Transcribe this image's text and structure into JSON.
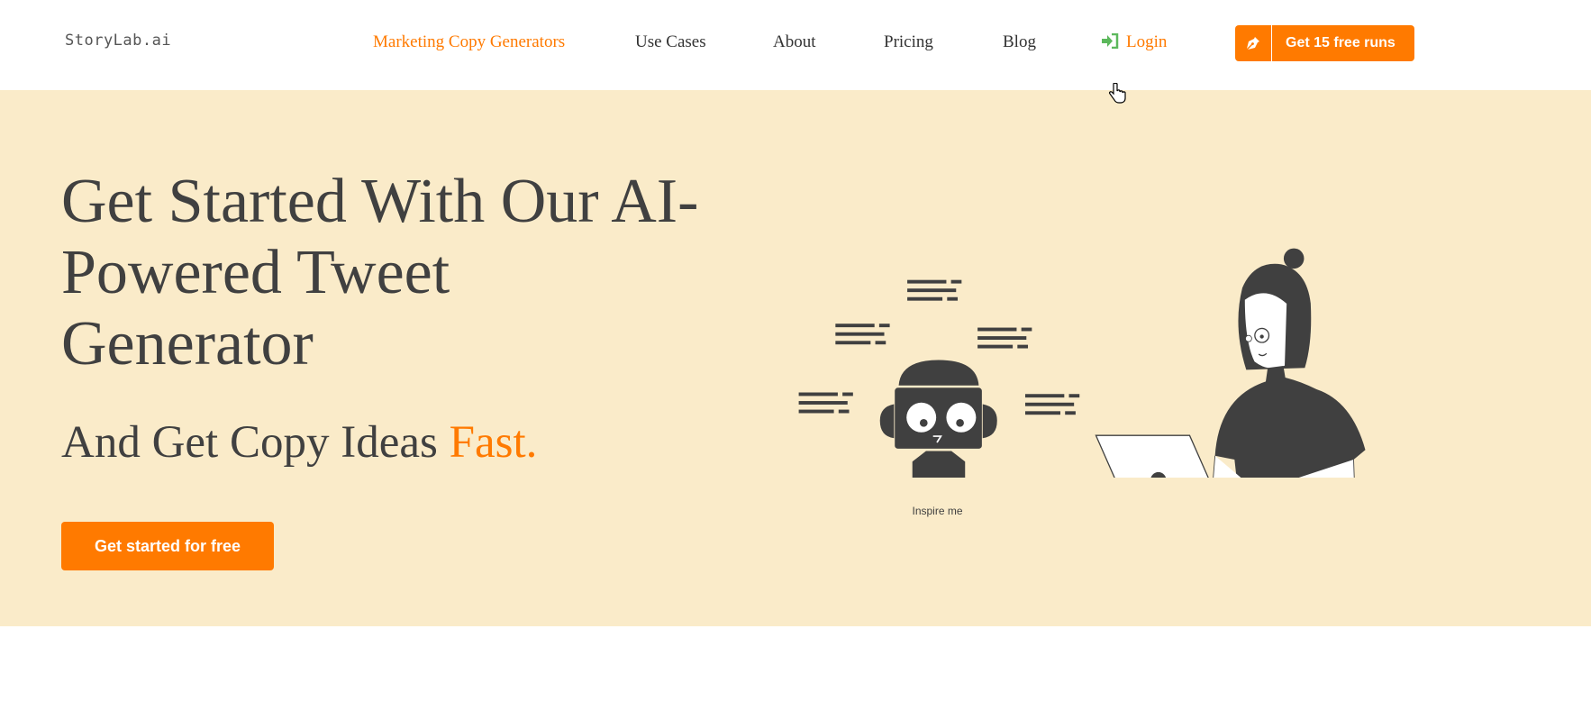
{
  "header": {
    "logo": "StoryLab.ai",
    "nav": [
      {
        "label": "Marketing Copy Generators",
        "active": true
      },
      {
        "label": "Use Cases"
      },
      {
        "label": "About"
      },
      {
        "label": "Pricing"
      },
      {
        "label": "Blog"
      }
    ],
    "login": {
      "label": "Login",
      "icon": "sign-in-icon"
    },
    "cta": {
      "label": "Get 15 free runs",
      "icon": "pen-nib-icon"
    }
  },
  "hero": {
    "title": "Get Started With Our AI-Powered Tweet Generator",
    "subtitle_prefix": "And Get Copy Ideas ",
    "subtitle_accent": "Fast.",
    "button": "Get started for free",
    "illustration": {
      "robot_button": "Inspire me"
    }
  },
  "colors": {
    "accent": "#ff7a00",
    "hero_bg": "#faebc9",
    "text": "#404040",
    "login_icon": "#5cb85c"
  }
}
